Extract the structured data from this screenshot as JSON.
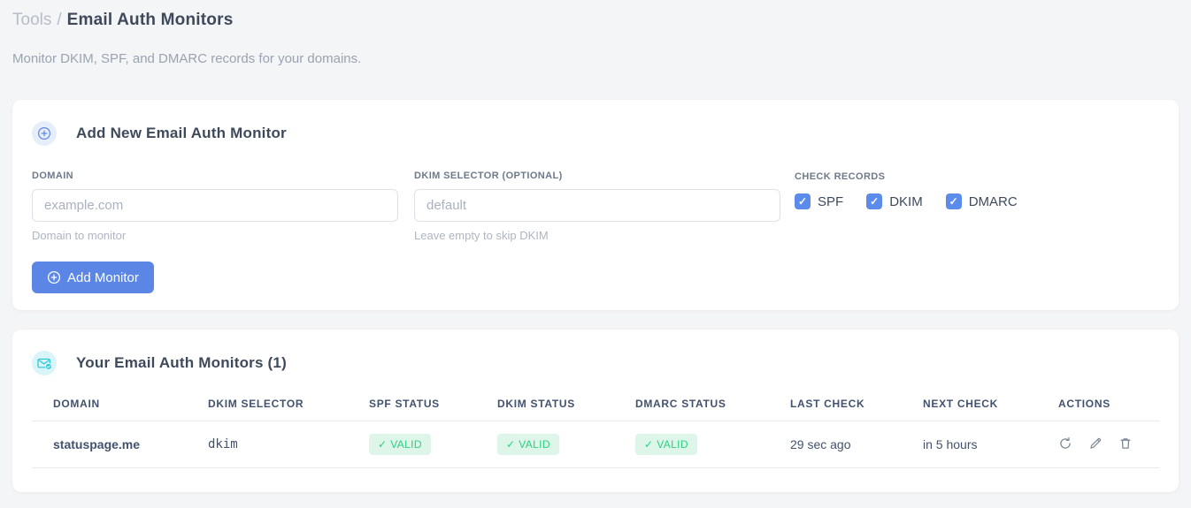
{
  "page": {
    "breadcrumb": {
      "section": "Tools",
      "separator": "/",
      "title": "Email Auth Monitors"
    },
    "subtitle": "Monitor DKIM, SPF, and DMARC records for your domains."
  },
  "add_monitor_card": {
    "title": "Add New Email Auth Monitor",
    "domain_field": {
      "label": "Domain",
      "placeholder": "example.com",
      "value": "",
      "hint": "Domain to monitor"
    },
    "dkim_selector_field": {
      "label": "DKIM Selector (optional)",
      "placeholder": "default",
      "value": "",
      "hint": "Leave empty to skip DKIM"
    },
    "check_records": {
      "label": "Check Records",
      "options": [
        {
          "label": "SPF",
          "checked": true,
          "check_glyph": "✓"
        },
        {
          "label": "DKIM",
          "checked": true,
          "check_glyph": "✓"
        },
        {
          "label": "DMARC",
          "checked": true,
          "check_glyph": "✓"
        }
      ]
    },
    "submit_label": "Add Monitor"
  },
  "monitors_card": {
    "title": "Your Email Auth Monitors (1)",
    "count": 1,
    "table": {
      "headers": [
        "Domain",
        "DKIM Selector",
        "SPF Status",
        "DKIM Status",
        "DMARC Status",
        "Last Check",
        "Next Check",
        "Actions"
      ],
      "rows": [
        {
          "domain": "statuspage.me",
          "dkim_selector": "dkim",
          "spf_status": "✓ VALID",
          "dkim_status": "✓ VALID",
          "dmarc_status": "✓ VALID",
          "last_check": "29 sec ago",
          "next_check": "in 5 hours",
          "actions": [
            "refresh",
            "edit",
            "delete"
          ]
        }
      ]
    }
  },
  "colors": {
    "accent_blue": "#5b86e6",
    "checkbox_blue": "#5b8cec",
    "valid_badge_bg": "#ddf6e9",
    "valid_badge_text": "#2ecf80",
    "code_pink": "#e8437a",
    "icon_cyan": "#25c5d8",
    "page_background": "#f4f5f6"
  }
}
